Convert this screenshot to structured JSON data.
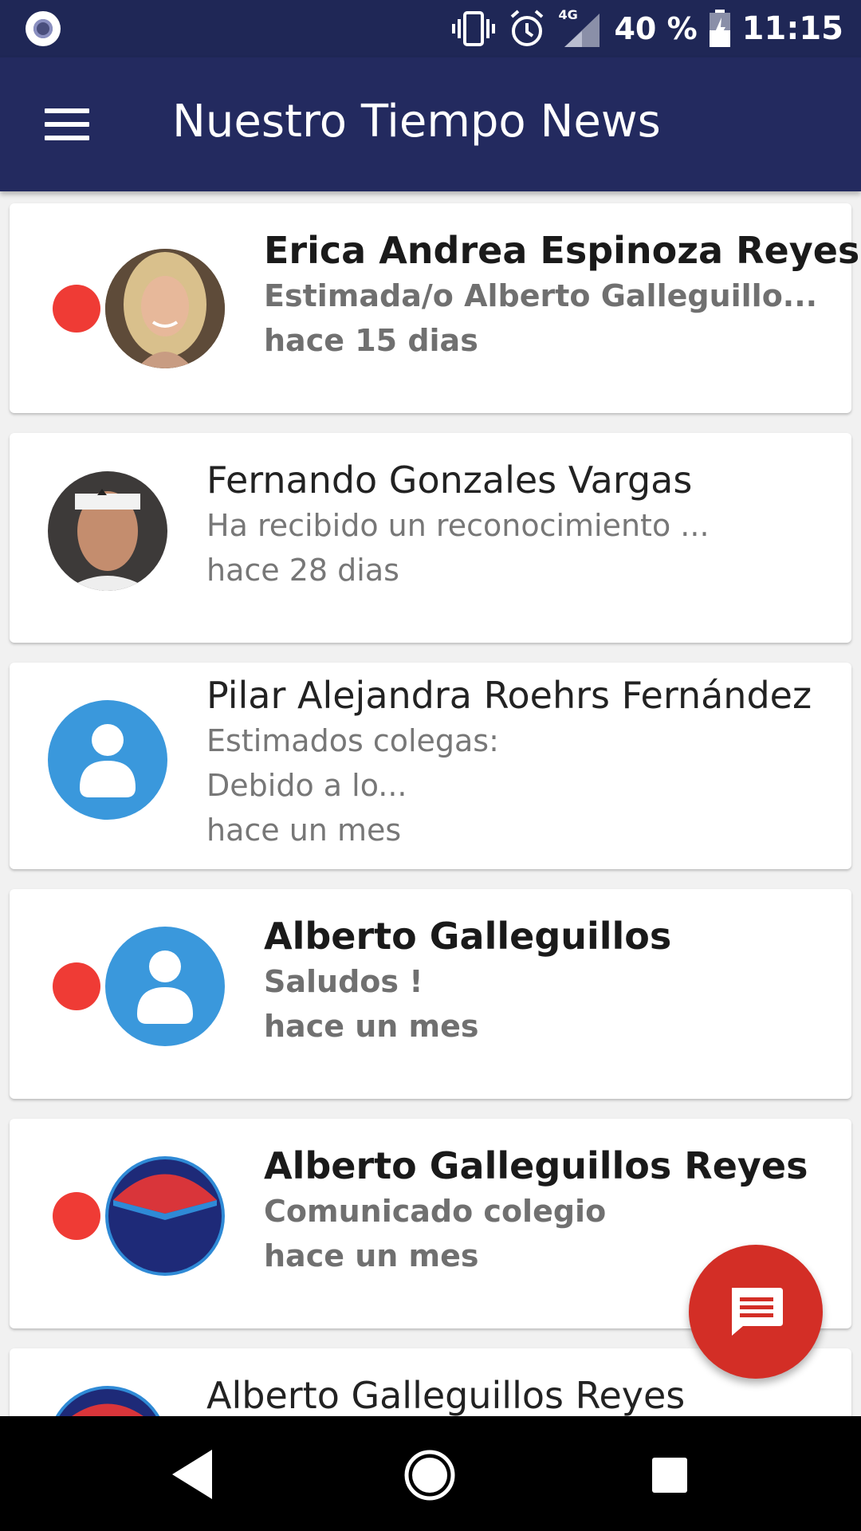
{
  "status_bar": {
    "network": "4G",
    "battery": "40 %",
    "time": "11:15"
  },
  "app_bar": {
    "title": "Nuestro Tiempo News"
  },
  "messages": [
    {
      "name": "Erica Andrea Espinoza Reyes",
      "preview": "Estimada/o Alberto Galleguillo...",
      "time": "hace 15 dias",
      "unread": true,
      "avatar": "photo-woman"
    },
    {
      "name": "Fernando Gonzales Vargas",
      "preview": "Ha recibido un reconocimiento ...",
      "time": "hace 28 dias",
      "unread": false,
      "avatar": "photo-man"
    },
    {
      "name": "Pilar Alejandra  Roehrs Fernández",
      "preview": "Estimados colegas:",
      "preview_line2": "Debido a lo...",
      "time": "hace un mes",
      "unread": false,
      "avatar": "default-person-icon"
    },
    {
      "name": "Alberto Galleguillos",
      "preview": "Saludos !",
      "time": "hace un mes",
      "unread": true,
      "avatar": "default-person-icon"
    },
    {
      "name": "Alberto Galleguillos Reyes",
      "preview": "Comunicado colegio",
      "time": "hace un mes",
      "unread": true,
      "avatar": "school-logo"
    },
    {
      "name": "Alberto Galleguillos Reyes",
      "unread": false,
      "avatar": "school-logo"
    }
  ],
  "colors": {
    "app_bar": "#232a5f",
    "status_bar": "#1f2756",
    "unread_dot": "#ef3b35",
    "fab": "#d32e26",
    "avatar_blue": "#3a98dc"
  },
  "icons": [
    "menu-icon",
    "vibrate-icon",
    "alarm-icon",
    "signal-icon",
    "battery-icon",
    "message-icon",
    "back-icon",
    "home-icon",
    "recents-icon"
  ]
}
